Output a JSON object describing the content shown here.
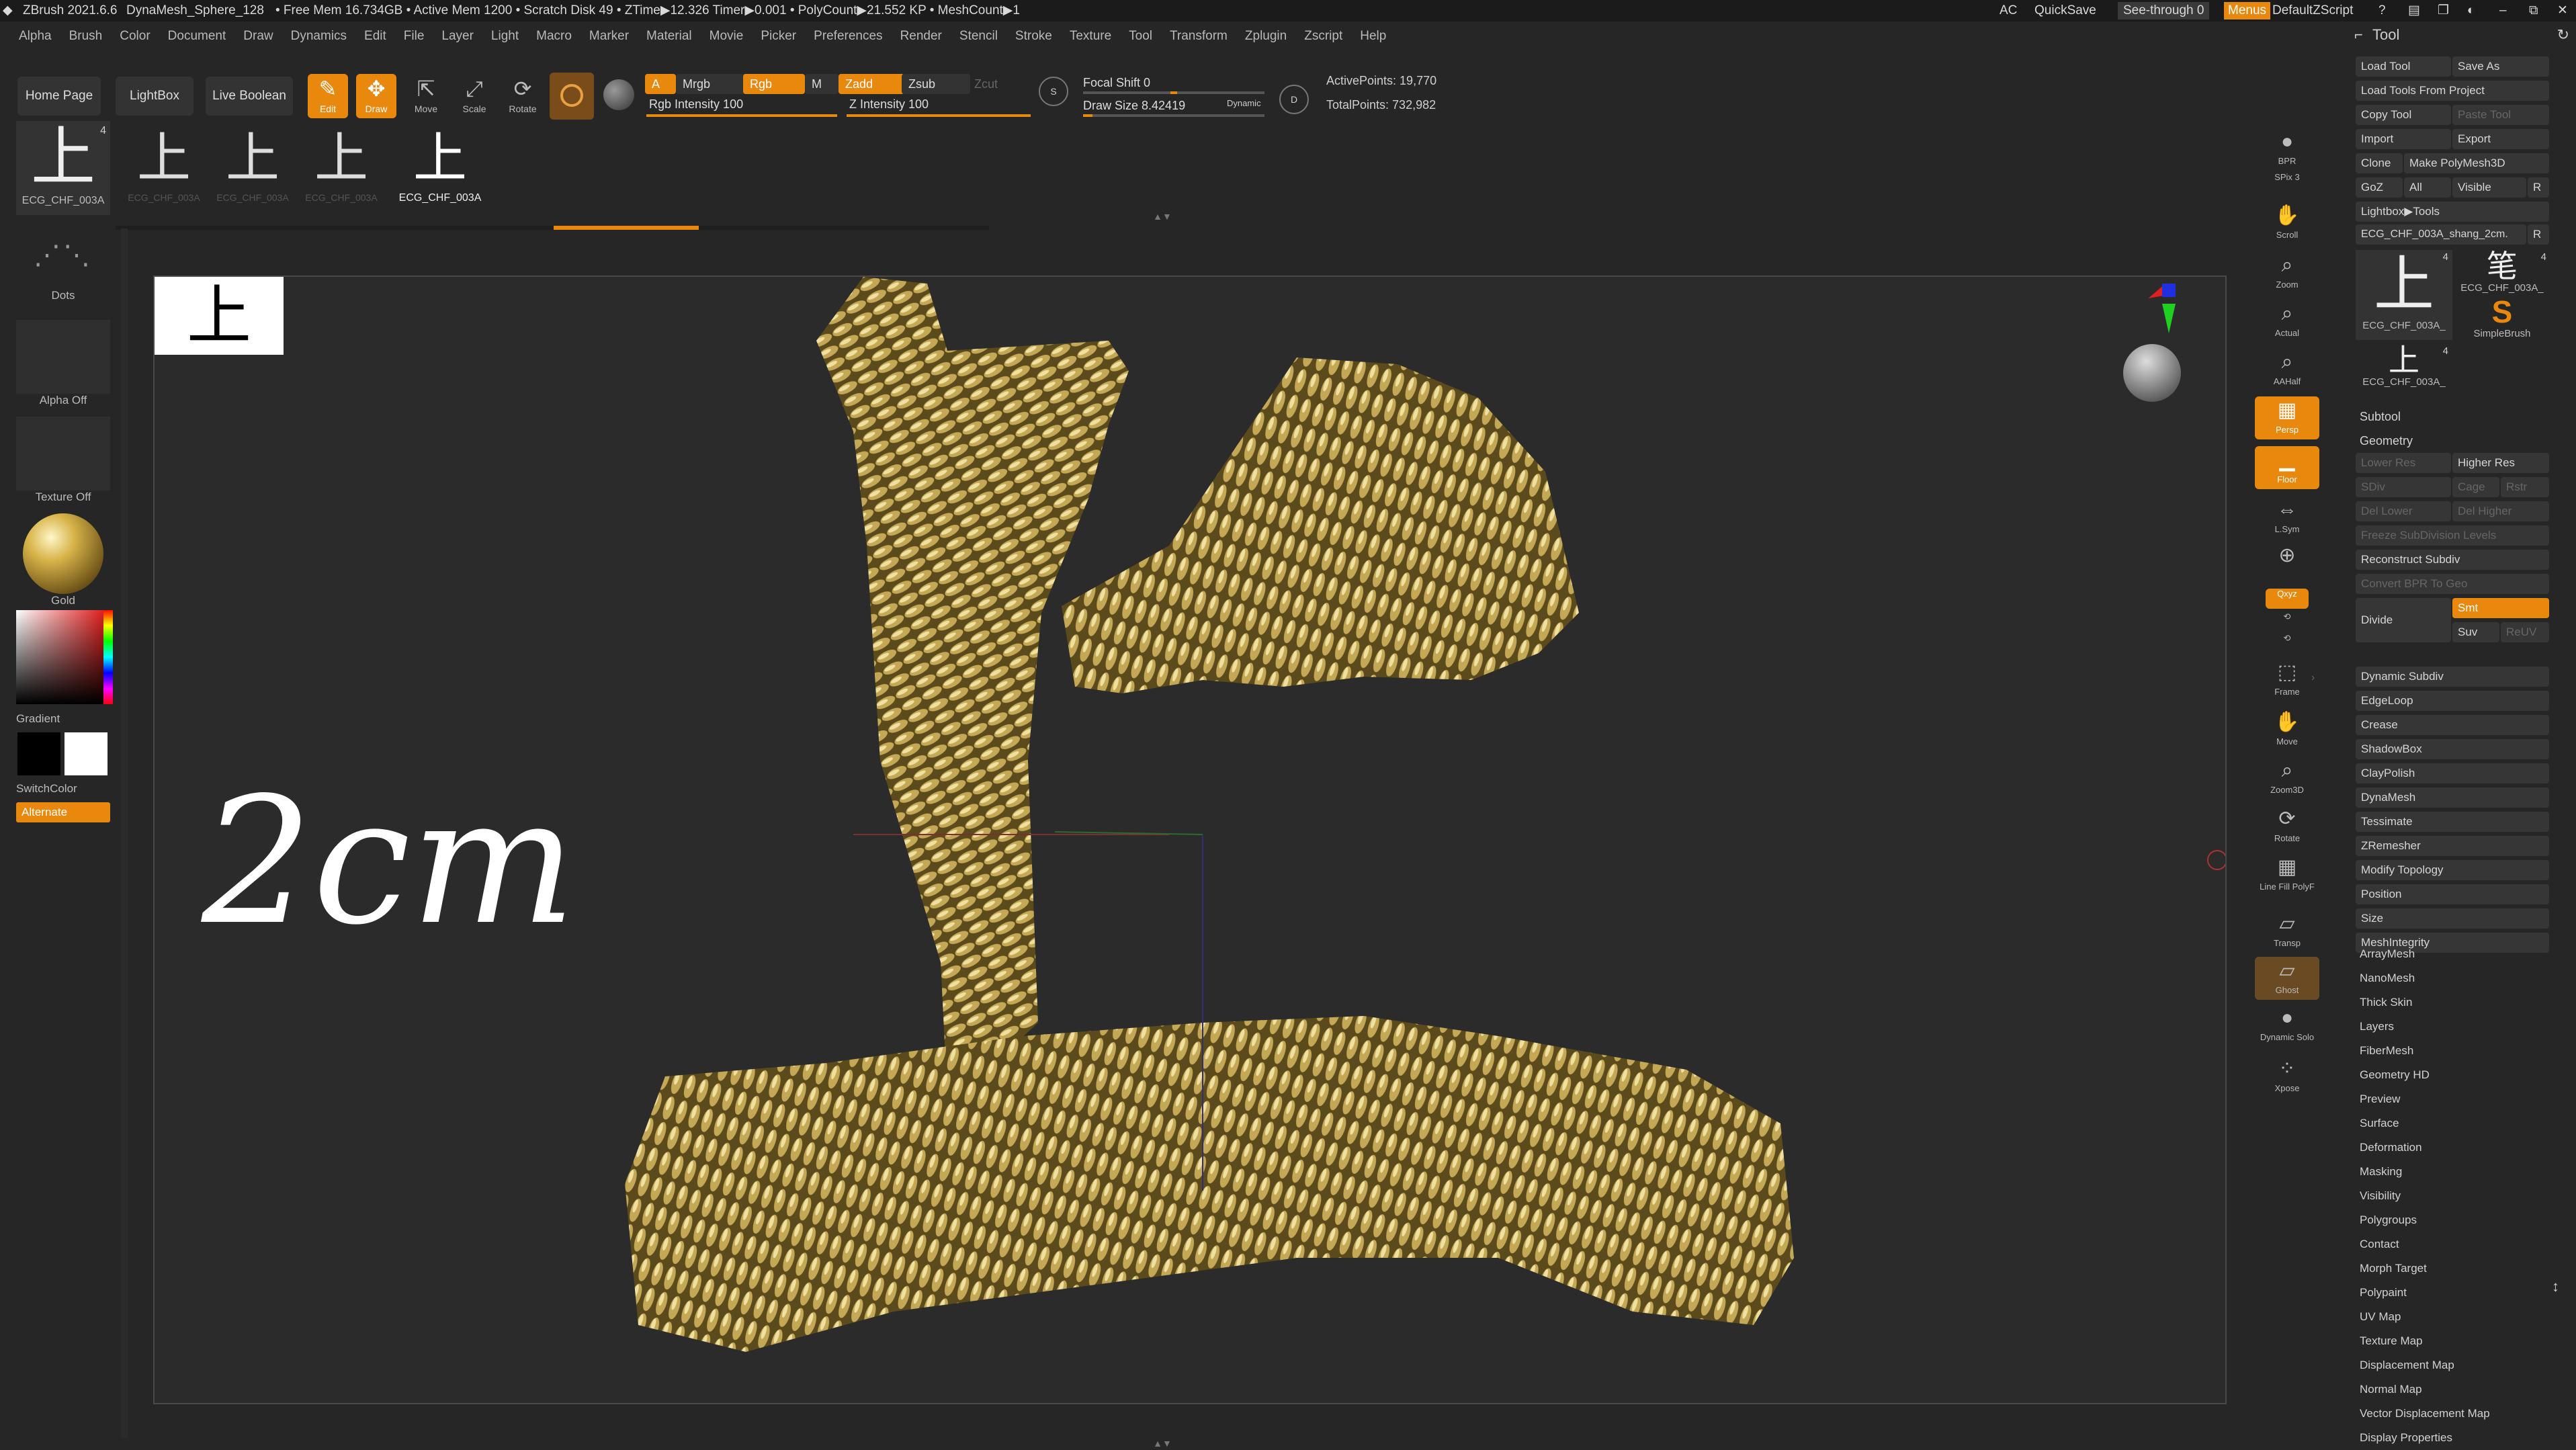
{
  "titlebar": {
    "app": "ZBrush 2021.6.6",
    "mesh": "DynaMesh_Sphere_128",
    "stats": "• Free Mem 16.734GB • Active Mem 1200 • Scratch Disk 49 • ZTime▶12.326 Timer▶0.001 • PolyCount▶21.552 KP • MeshCount▶1",
    "ac": "AC",
    "quicksave": "QuickSave",
    "see_through": "See-through  0",
    "menus": "Menus",
    "zscript": "DefaultZScript"
  },
  "menu": [
    "Alpha",
    "Brush",
    "Color",
    "Document",
    "Draw",
    "Dynamics",
    "Edit",
    "File",
    "Layer",
    "Light",
    "Macro",
    "Marker",
    "Material",
    "Movie",
    "Picker",
    "Preferences",
    "Render",
    "Stencil",
    "Stroke",
    "Texture",
    "Tool",
    "Transform",
    "Zplugin",
    "Zscript",
    "Help"
  ],
  "toolbar": {
    "home_page": "Home Page",
    "lightbox": "LightBox",
    "live_boolean": "Live Boolean",
    "edit": "Edit",
    "draw": "Draw",
    "move": "Move",
    "scale": "Scale",
    "rotate": "Rotate",
    "a": "A",
    "mrgb": "Mrgb",
    "rgb": "Rgb",
    "m": "M",
    "zadd": "Zadd",
    "zsub": "Zsub",
    "zcut": "Zcut",
    "rgb_intensity": "Rgb Intensity 100",
    "rgb_intensity_value": 100,
    "z_intensity": "Z Intensity 100",
    "z_intensity_value": 100,
    "focal_shift": "Focal Shift 0",
    "draw_size": "Draw Size 8.42419",
    "dynamic": "Dynamic",
    "active_points": "ActivePoints: 19,770",
    "total_points": "TotalPoints: 732,982",
    "s": "S",
    "d": "D"
  },
  "recent_tools": [
    {
      "label": "ECG_CHF_003A"
    },
    {
      "label": "ECG_CHF_003A"
    },
    {
      "label": "ECG_CHF_003A"
    },
    {
      "label": "ECG_CHF_003A"
    }
  ],
  "left": {
    "current_tool_label": "ECG_CHF_003A",
    "current_tool_count": "4",
    "dots": "Dots",
    "alpha": "Alpha Off",
    "texture": "Texture Off",
    "material": "Gold",
    "gradient": "Gradient",
    "switch_color": "SwitchColor",
    "alternate": "Alternate"
  },
  "viewport": {
    "inset_glyph": "上",
    "annotation": "2cm"
  },
  "shelf": [
    "BPR",
    "SPix 3",
    "Scroll",
    "Zoom",
    "Actual",
    "AAHalf",
    "Persp",
    "Floor",
    "L.Sym",
    "",
    "Qxyz",
    "",
    "",
    "Frame",
    "Move",
    "Zoom3D",
    "Rotate",
    "Line Fill PolyF",
    "Transp",
    "Ghost",
    "Dynamic Solo",
    "Xpose"
  ],
  "tool": {
    "title": "Tool",
    "load_tool": "Load Tool",
    "save_as": "Save As",
    "load_from_project": "Load Tools From Project",
    "copy_tool": "Copy Tool",
    "paste_tool": "Paste Tool",
    "import": "Import",
    "export": "Export",
    "clone": "Clone",
    "make_polymesh": "Make PolyMesh3D",
    "goz": "GoZ",
    "all": "All",
    "visible": "Visible",
    "r": "R",
    "lightbox_tools": "Lightbox▶Tools",
    "current": "ECG_CHF_003A_shang_2cm.",
    "thumb1": "ECG_CHF_003A_",
    "thumb2": "ECG_CHF_003A_",
    "thumb3": "SimpleBrush",
    "thumb4": "ECG_CHF_003A_",
    "thumb_count": "4",
    "subtool": "Subtool",
    "geometry": "Geometry",
    "lower_res": "Lower Res",
    "higher_res": "Higher Res",
    "sdiv": "SDiv",
    "cage": "Cage",
    "rstr": "Rstr",
    "del_lower": "Del Lower",
    "del_higher": "Del Higher",
    "freeze": "Freeze SubDivision Levels",
    "reconstruct": "Reconstruct Subdiv",
    "convert_bpr": "Convert BPR To Geo",
    "divide": "Divide",
    "smt": "Smt",
    "suv": "Suv",
    "reuv": "ReUV",
    "geo_items": [
      "Dynamic Subdiv",
      "EdgeLoop",
      "Crease",
      "ShadowBox",
      "ClayPolish",
      "DynaMesh",
      "Tessimate",
      "ZRemesher",
      "Modify Topology",
      "Position",
      "Size",
      "MeshIntegrity"
    ],
    "sections": [
      "ArrayMesh",
      "NanoMesh",
      "Thick Skin",
      "Layers",
      "FiberMesh",
      "Geometry HD",
      "Preview",
      "Surface",
      "Deformation",
      "Masking",
      "Visibility",
      "Polygroups",
      "Contact",
      "Morph Target",
      "Polypaint",
      "UV Map",
      "Texture Map",
      "Displacement Map",
      "Normal Map",
      "Vector Displacement Map",
      "Display Properties"
    ]
  },
  "colors": {
    "accent": "#e8890e",
    "gold": "#b99a45",
    "panel": "#262626"
  }
}
